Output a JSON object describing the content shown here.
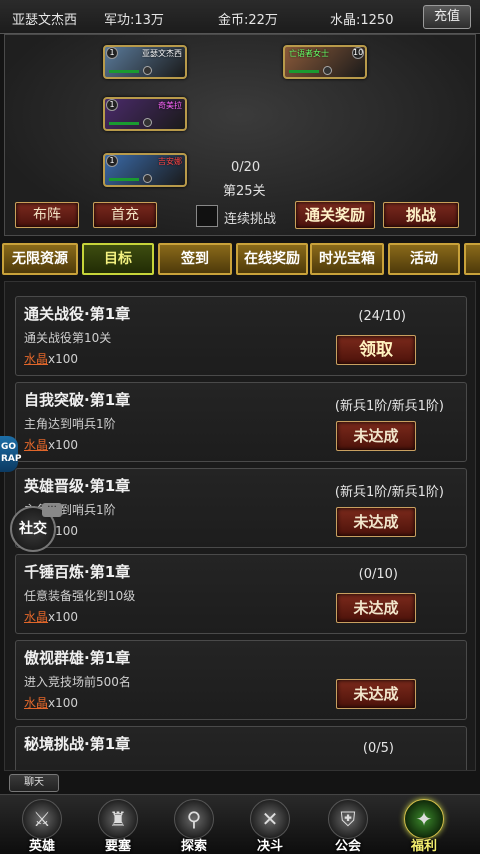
{
  "topbar": {
    "player_name": "亚瑟文杰西",
    "power": "军功:13万",
    "gold": "金币:22万",
    "crystal": "水晶:1250",
    "recharge_label": "充值"
  },
  "battle": {
    "allies": [
      {
        "level": "1",
        "name": "亚瑟文杰西",
        "name_color": "#ffffff",
        "portrait": "#5a7a9a"
      },
      {
        "level": "1",
        "name": "奇美拉",
        "name_color": "#ff66ff",
        "portrait": "#4a2a6a"
      },
      {
        "level": "1",
        "name": "吉安娜",
        "name_color": "#ff4444",
        "portrait": "#3a6aa8"
      }
    ],
    "enemy": {
      "level": "10",
      "name": "亡语者女士",
      "name_color": "#66ff66",
      "portrait": "#8a5a3a"
    },
    "progress": "0/20",
    "stage": "第25关",
    "formation_label": "布阵",
    "first_charge_label": "首充",
    "auto_label": "连续挑战",
    "clear_reward_label": "通关奖励",
    "challenge_label": "挑战"
  },
  "tabs": [
    {
      "label": "无限资源",
      "active": false
    },
    {
      "label": "目标",
      "active": true
    },
    {
      "label": "签到",
      "active": false
    },
    {
      "label": "在线奖励",
      "active": false
    },
    {
      "label": "时光宝箱",
      "active": false
    },
    {
      "label": "活动",
      "active": false
    }
  ],
  "quests": [
    {
      "title": "通关战役·第1章",
      "desc": "通关战役第10关",
      "reward_res": "水晶",
      "reward_qty": "x100",
      "progress": "(24/10)",
      "button": "领取",
      "claimable": true
    },
    {
      "title": "自我突破·第1章",
      "desc": "主角达到哨兵1阶",
      "reward_res": "水晶",
      "reward_qty": "x100",
      "progress": "(新兵1阶/新兵1阶)",
      "button": "未达成",
      "claimable": false
    },
    {
      "title": "英雄晋级·第1章",
      "desc": "主角达到哨兵1阶",
      "reward_res": "水晶",
      "reward_qty": "x100",
      "progress": "(新兵1阶/新兵1阶)",
      "button": "未达成",
      "claimable": false
    },
    {
      "title": "千锤百炼·第1章",
      "desc": "任意装备强化到10级",
      "reward_res": "水晶",
      "reward_qty": "x100",
      "progress": "(0/10)",
      "button": "未达成",
      "claimable": false
    },
    {
      "title": "傲视群雄·第1章",
      "desc": "进入竞技场前500名",
      "reward_res": "水晶",
      "reward_qty": "x100",
      "progress": "",
      "button": "未达成",
      "claimable": false
    },
    {
      "title": "秘境挑战·第1章",
      "desc": "",
      "reward_res": "",
      "reward_qty": "",
      "progress": "(0/5)",
      "button": "",
      "claimable": false
    }
  ],
  "social_label": "社交",
  "chat_label": "聊天",
  "nav": [
    {
      "label": "英雄",
      "icon": "hero-icon",
      "glyph": "⚔",
      "active": false
    },
    {
      "label": "要塞",
      "icon": "fortress-icon",
      "glyph": "♜",
      "active": false
    },
    {
      "label": "探索",
      "icon": "explore-icon",
      "glyph": "⚲",
      "active": false
    },
    {
      "label": "决斗",
      "icon": "duel-icon",
      "glyph": "✕",
      "active": false
    },
    {
      "label": "公会",
      "icon": "guild-icon",
      "glyph": "⛨",
      "active": false
    },
    {
      "label": "福利",
      "icon": "welfare-icon",
      "glyph": "✦",
      "active": true
    }
  ]
}
